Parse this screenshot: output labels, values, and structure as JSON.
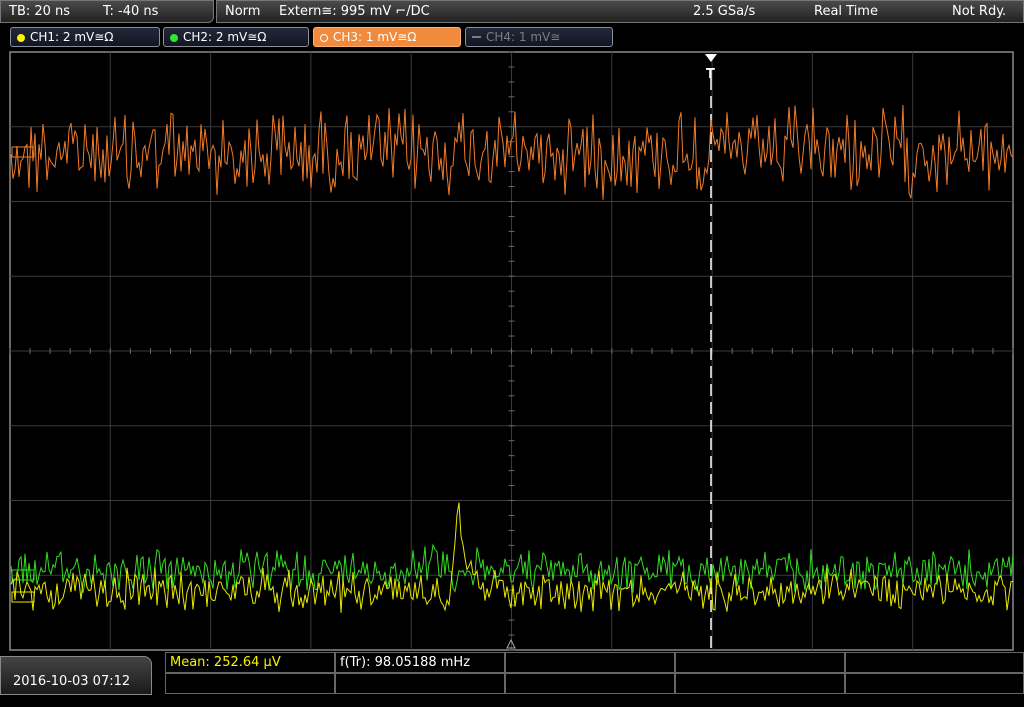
{
  "status_bar": {
    "timebase": "TB: 20 ns",
    "trigger_time": "T: -40 ns",
    "trigger_mode": "Norm",
    "trigger_source": "Extern≅: 995 mV ⌐/DC",
    "sample_rate": "2.5 GSa/s",
    "acq_mode": "Real Time",
    "acq_status": "Not Rdy."
  },
  "channels": [
    {
      "label": "CH1: 2 mV≅Ω",
      "color": "#f5f500"
    },
    {
      "label": "CH2: 2 mV≅Ω",
      "color": "#2fe82f"
    },
    {
      "label": "CH3: 1 mV≅Ω",
      "color": "#f08a3c"
    },
    {
      "label": "CH4: 1 mV≅",
      "color": "#7d7d7d"
    }
  ],
  "plot": {
    "ch3_color": "#f07b2a",
    "ch2_color": "#33dd22",
    "ch1_color": "#e8e800",
    "ch1_pulse_level": 0.62
  },
  "measurements": {
    "mean": "Mean: 252.64 µV",
    "mean_color": "#f5f500",
    "freq": "f(Tr): 98.05188 mHz"
  },
  "datetime": "2016-10-03 07:12"
}
